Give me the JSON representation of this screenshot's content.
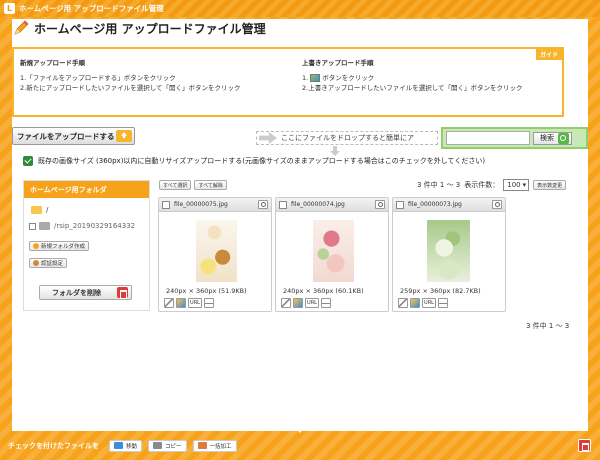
{
  "window": {
    "title": "ホームページ用 アップロードファイル管理",
    "logo_text": "L"
  },
  "page": {
    "title": "ホームページ用 アップロードファイル管理"
  },
  "guide": {
    "badge": "ガイド",
    "new_upload": {
      "heading": "新規アップロード手順",
      "step1": "1.「ファイルをアップロードする」ボタンをクリック",
      "step2": "2.新たにアップロードしたいファイルを選択して「開く」ボタンをクリック"
    },
    "overwrite": {
      "heading": "上書きアップロード手順",
      "step1_prefix": "1.",
      "step1_suffix": "ボタンをクリック",
      "step2": "2.上書きアップロードしたいファイルを選択して「開く」ボタンをクリック"
    }
  },
  "toolbar": {
    "upload_label": "ファイルをアップロードする",
    "drop_hint": "ここにファイルをドロップすると簡単にア",
    "search_value": "",
    "search_label": "検索"
  },
  "resize": {
    "checked": true,
    "label": "既存の画像サイズ (360px)以内に自動リサイズアップロードする(元画像サイズのままアップロードする場合はこのチェックを外してください)"
  },
  "folders": {
    "heading": "ホームページ用フォルダ",
    "items": [
      {
        "label": "/"
      },
      {
        "label": "/rsip_20190329164332"
      }
    ],
    "new_folder_label": "新規フォルダ作成",
    "auth_label": "認証設定",
    "delete_label": "フォルダを削除"
  },
  "list": {
    "select_all": "すべて選択",
    "deselect_all": "すべて解除",
    "count_text": "3 件中 1 ～ 3",
    "display_count_label": "表示件数：",
    "display_count_value": "100",
    "display_settings": "表示数変更",
    "count_text_bottom": "3 件中 1 ～ 3"
  },
  "files": [
    {
      "name": "file_00000075.jpg",
      "size": "240px × 360px (51.9KB)",
      "url_label": "URL"
    },
    {
      "name": "file_00000074.jpg",
      "size": "240px × 360px (60.1KB)",
      "url_label": "URL"
    },
    {
      "name": "file_00000073.jpg",
      "size": "259px × 360px (82.7KB)",
      "url_label": "URL"
    }
  ],
  "footer": {
    "label": "チェックを付けたファイルを",
    "move": "移動",
    "copy": "コピー",
    "batch": "一括加工"
  },
  "colors": {
    "accent": "#f7a21b",
    "search_bg": "#c9e8b5",
    "delete": "#e03a3a",
    "check": "#2e8b3a"
  }
}
